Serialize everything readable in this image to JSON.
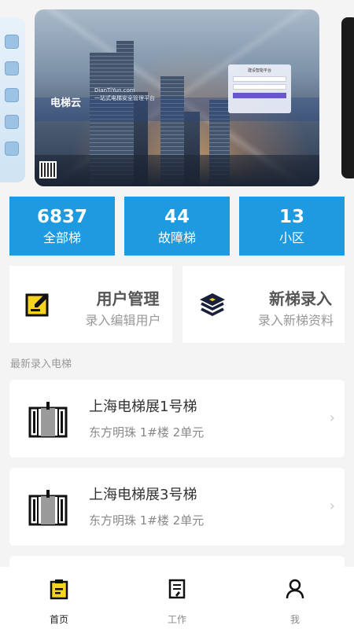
{
  "banner": {
    "logo_text": "电梯云",
    "slogan_url": "DianTiYun.com",
    "slogan_desc": "一站式电梯安全管理平台",
    "login_title": "建设智能平台"
  },
  "stats": [
    {
      "value": "6837",
      "label": "全部梯"
    },
    {
      "value": "44",
      "label": "故障梯"
    },
    {
      "value": "13",
      "label": "小区"
    }
  ],
  "actions": [
    {
      "title": "用户管理",
      "subtitle": "录入编辑用户",
      "icon": "edit-icon",
      "color": "#f5d31f"
    },
    {
      "title": "新梯录入",
      "subtitle": "录入新梯资料",
      "icon": "layers-icon",
      "color": "#1a1f3a"
    }
  ],
  "section_title": "最新录入电梯",
  "elevators": [
    {
      "name": "上海电梯展1号梯",
      "address": "东方明珠 1#楼 2单元"
    },
    {
      "name": "上海电梯展3号梯",
      "address": "东方明珠 1#楼 2单元"
    }
  ],
  "tabs": [
    {
      "label": "首页",
      "icon": "home-clipboard-icon",
      "active": true
    },
    {
      "label": "工作",
      "icon": "document-icon",
      "active": false
    },
    {
      "label": "我",
      "icon": "user-icon",
      "active": false
    }
  ],
  "colors": {
    "stat_bg": "#1e9ae0",
    "accent_yellow": "#f5d31f",
    "background": "#f4f4f4"
  }
}
